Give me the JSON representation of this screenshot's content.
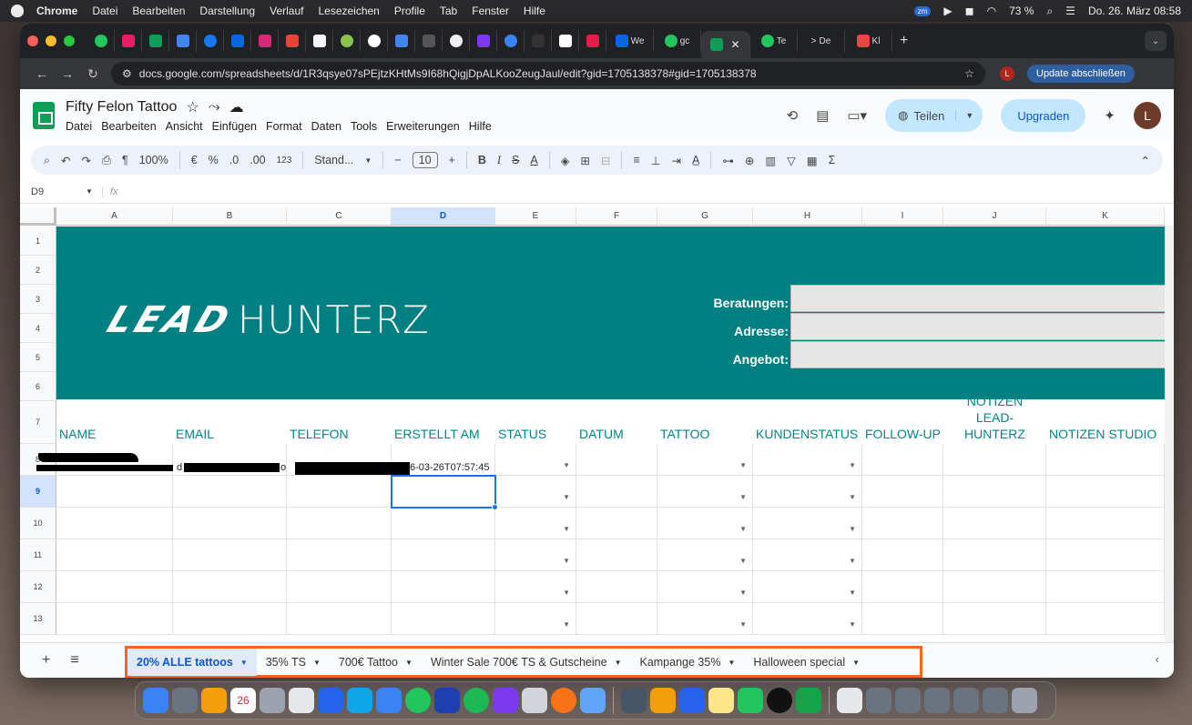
{
  "menubar": {
    "app": "Chrome",
    "items": [
      "Datei",
      "Bearbeiten",
      "Darstellung",
      "Verlauf",
      "Lesezeichen",
      "Profile",
      "Tab",
      "Fenster",
      "Hilfe"
    ],
    "zoom_badge": "zm",
    "battery": "73 %",
    "datetime": "Do. 26. März  08:58"
  },
  "browser": {
    "tab_labels": {
      "we": "We",
      "go": "gc",
      "te": "Te",
      "de": "De",
      "kl": "Kl"
    },
    "url": "docs.google.com/spreadsheets/d/1R3qsye07sPEjtzKHtMs9I68hQigjDpALKooZeugJaul/edit?gid=1705138378#gid=1705138378",
    "profile_initial": "L",
    "update_label": "Update abschließen"
  },
  "doc": {
    "title": "Fifty Felon Tattoo",
    "menu": [
      "Datei",
      "Bearbeiten",
      "Ansicht",
      "Einfügen",
      "Format",
      "Daten",
      "Tools",
      "Erweiterungen",
      "Hilfe"
    ],
    "share_label": "Teilen",
    "upgrade_label": "Upgraden",
    "avatar_initial": "L"
  },
  "toolbar": {
    "zoom": "100%",
    "currency": "€",
    "percent": "%",
    "dec_less": ".0",
    "dec_more": ".00",
    "num_format": "123",
    "font": "Stand...",
    "font_size": "10",
    "bold": "B",
    "italic": "I",
    "strike": "S",
    "text_color": "A",
    "sum": "Σ"
  },
  "formula_bar": {
    "cell_ref": "D9",
    "fx": "fx",
    "value": ""
  },
  "columns": [
    "A",
    "B",
    "C",
    "D",
    "E",
    "F",
    "G",
    "H",
    "I",
    "J",
    "K"
  ],
  "rows": [
    "1",
    "2",
    "3",
    "4",
    "5",
    "6",
    "7",
    "8",
    "9",
    "10",
    "11",
    "12",
    "13"
  ],
  "banner": {
    "logo_bold": "LEAD",
    "logo_light": "HUNTERZ",
    "fields": [
      "Beratungen:",
      "Adresse:",
      "Angebot:"
    ],
    "bg_color": "#008080"
  },
  "headers": [
    "NAME",
    "EMAIL",
    "TELEFON",
    "ERSTELLT AM",
    "STATUS",
    "DATUM",
    "TATTOO",
    "KUNDENSTATUS",
    "FOLLOW-UP",
    "NOTIZEN LEAD-HUNTERZ",
    "NOTIZEN STUDIO"
  ],
  "row8": {
    "email_start": "d",
    "email_end": "o",
    "created": "6-03-26T07:57:45"
  },
  "sheet_tabs": [
    {
      "label": "20% ALLE tattoos",
      "active": true
    },
    {
      "label": "35% TS",
      "active": false
    },
    {
      "label": "700€ Tattoo",
      "active": false
    },
    {
      "label": "Winter Sale 700€ TS & Gutscheine",
      "active": false
    },
    {
      "label": "Kampange 35%",
      "active": false
    },
    {
      "label": "Halloween special",
      "active": false
    }
  ],
  "dock": {
    "calendar_day": "26"
  },
  "colors": {
    "accent": "#0b57d0",
    "header_text": "#00868b",
    "highlight": "#f26522"
  }
}
